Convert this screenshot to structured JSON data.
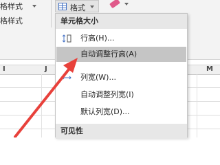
{
  "ribbon": {
    "style_group_label": "格样式",
    "style_group_label_lower": "格样式",
    "format_label": "格式"
  },
  "sheet": {
    "col_letters": [
      "I",
      "J",
      "M"
    ]
  },
  "menu": {
    "section_cell_size": "单元格大小",
    "items": [
      {
        "label": "行高(H)...",
        "icon": "row-height-icon"
      },
      {
        "label": "自动调整行高(A)",
        "icon": "none"
      },
      {
        "label": "列宽(W)...",
        "icon": "column-width-icon"
      },
      {
        "label": "自动调整列宽(I)",
        "icon": "none"
      },
      {
        "label": "默认列宽(D)...",
        "icon": "none"
      }
    ],
    "section_visibility": "可见性"
  },
  "colors": {
    "accent_arrow": "#e8413b",
    "menu_highlight": "#c5c5c5",
    "section_bg": "#e7e7e7"
  }
}
